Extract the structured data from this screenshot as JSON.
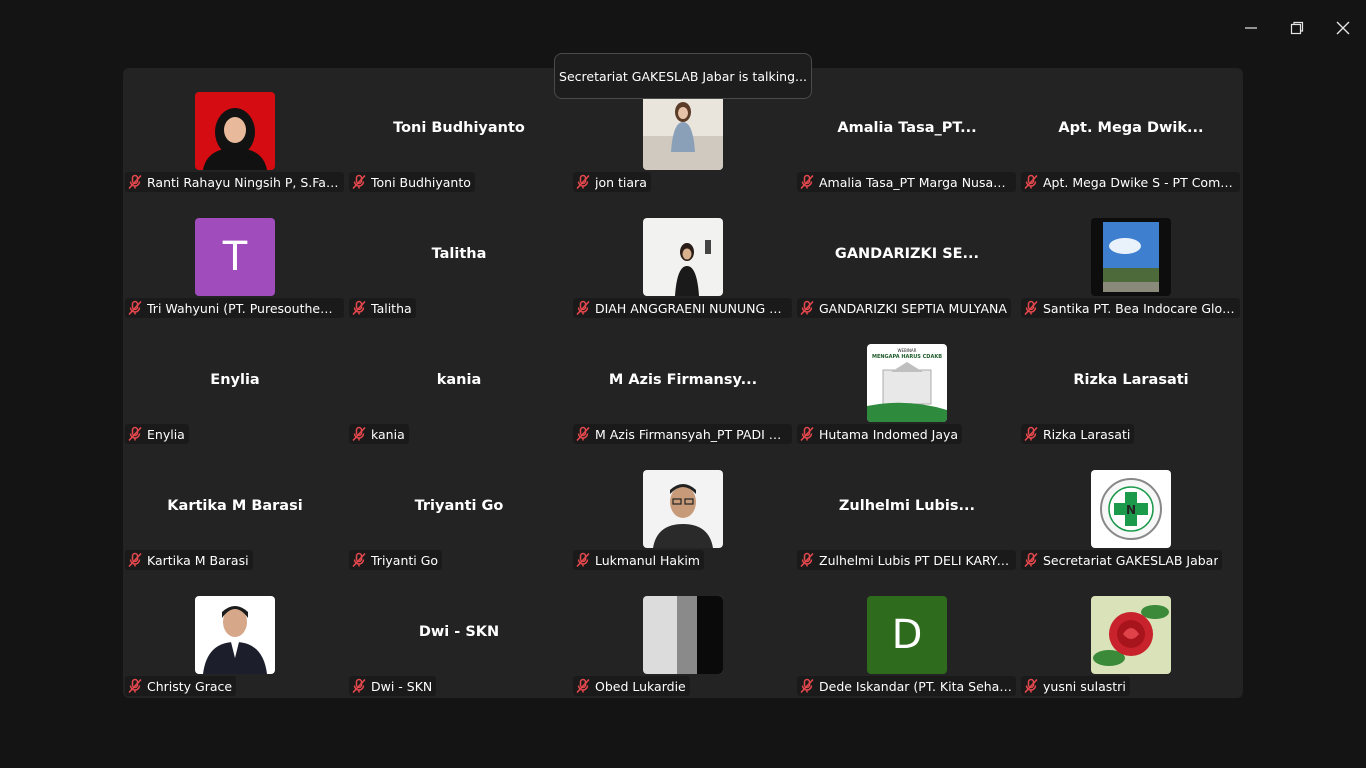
{
  "window": {
    "controls": [
      {
        "icon": "minimize-icon"
      },
      {
        "icon": "maximize-icon"
      },
      {
        "icon": "close-icon"
      }
    ]
  },
  "talking_indicator": "Secretariat GAKESLAB Jabar is talking...",
  "participants": [
    {
      "label": "Ranti Rahayu Ningsih P, S.Farm",
      "display_name": "",
      "avatar": "photo-red",
      "muted": true
    },
    {
      "label": "Toni Budhiyanto",
      "display_name": "Toni Budhiyanto",
      "avatar": "none",
      "muted": true
    },
    {
      "label": "jon tiara",
      "display_name": "",
      "avatar": "photo-light",
      "muted": true
    },
    {
      "label": "Amalia Tasa_PT Marga Nusantar...",
      "display_name": "Amalia  Tasa_PT...",
      "avatar": "none",
      "muted": true
    },
    {
      "label": "Apt. Mega Dwike S - PT Combi P...",
      "display_name": "Apt. Mega  Dwik...",
      "avatar": "none",
      "muted": true
    },
    {
      "label": "Tri Wahyuni (PT. Puresoutheast A...",
      "display_name": "",
      "avatar": "letter",
      "letter": "T",
      "avatar_color": "#a04cbd",
      "muted": true
    },
    {
      "label": "Talitha",
      "display_name": "Talitha",
      "avatar": "none",
      "muted": true
    },
    {
      "label": "DIAH ANGGRAENI NUNUNG PAT...",
      "display_name": "",
      "avatar": "photo-white",
      "muted": true
    },
    {
      "label": "GANDARIZKI SEPTIA MULYANA",
      "display_name": "GANDARIZKI  SE...",
      "avatar": "none",
      "muted": true
    },
    {
      "label": "Santika PT. Bea Indocare Global",
      "display_name": "",
      "avatar": "photo-sky",
      "muted": true
    },
    {
      "label": "Enylia",
      "display_name": "Enylia",
      "avatar": "none",
      "muted": true
    },
    {
      "label": "kania",
      "display_name": "kania",
      "avatar": "none",
      "muted": true
    },
    {
      "label": "M Azis Firmansyah_PT PADI HIJA...",
      "display_name": "M Azis  Firmansy...",
      "avatar": "none",
      "muted": true
    },
    {
      "label": "Hutama Indomed Jaya",
      "display_name": "",
      "avatar": "photo-webinar",
      "muted": true
    },
    {
      "label": "Rizka Larasati",
      "display_name": "Rizka Larasati",
      "avatar": "none",
      "muted": true
    },
    {
      "label": "Kartika M Barasi",
      "display_name": "Kartika M Barasi",
      "avatar": "none",
      "muted": true
    },
    {
      "label": "Triyanti Go",
      "display_name": "Triyanti Go",
      "avatar": "none",
      "muted": true
    },
    {
      "label": "Lukmanul Hakim",
      "display_name": "",
      "avatar": "photo-man",
      "muted": true
    },
    {
      "label": "Zulhelmi Lubis PT DELI KARYA PR...",
      "display_name": "Zulhelmi  Lubis...",
      "avatar": "none",
      "muted": true
    },
    {
      "label": "Secretariat GAKESLAB Jabar",
      "display_name": "",
      "avatar": "photo-logo",
      "muted": true
    },
    {
      "label": "Christy Grace",
      "display_name": "",
      "avatar": "photo-suit",
      "muted": true
    },
    {
      "label": "Dwi - SKN",
      "display_name": "Dwi - SKN",
      "avatar": "none",
      "muted": true
    },
    {
      "label": "Obed Lukardie",
      "display_name": "",
      "avatar": "photo-gray",
      "muted": true
    },
    {
      "label": "Dede Iskandar (PT. Kita Sehati G...",
      "display_name": "",
      "avatar": "letter",
      "letter": "D",
      "avatar_color": "#2f6b1c",
      "muted": true
    },
    {
      "label": "yusni sulastri",
      "display_name": "",
      "avatar": "photo-rose",
      "muted": true
    }
  ],
  "webinar_banner": {
    "line1": "WEBINAR",
    "line2": "MENGAPA HARUS CDAKB"
  }
}
